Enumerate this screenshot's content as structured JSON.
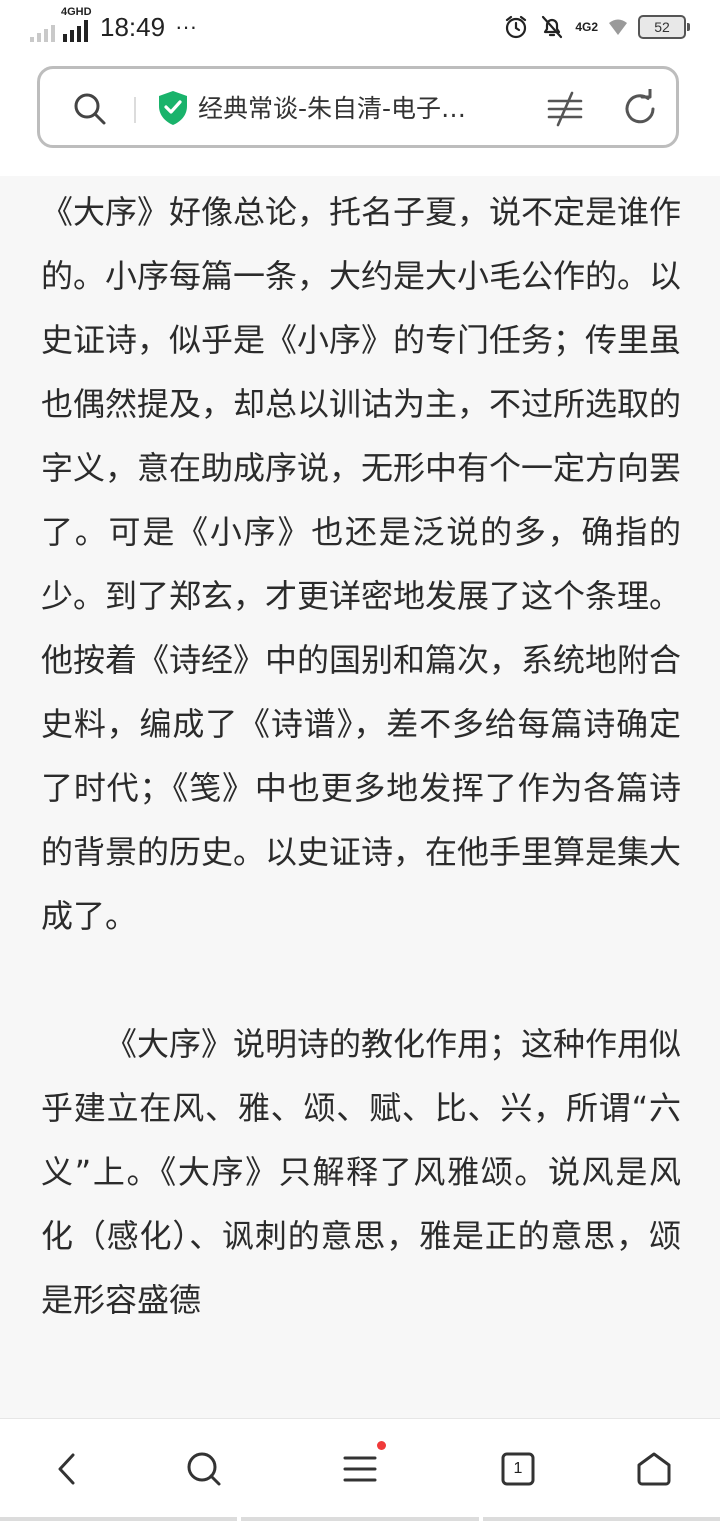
{
  "status_bar": {
    "network_label": "4GHD",
    "time": "18:49",
    "more": "···",
    "network_label_2": "4G2",
    "battery": "52"
  },
  "address_bar": {
    "title": "经典常谈-朱自清-电子…"
  },
  "article": {
    "paragraphs": [
      "《大序》好像总论，托名子夏，说不定是谁作的。小序每篇一条，大约是大小毛公作的。以史证诗，似乎是《小序》的专门任务；传里虽也偶然提及，却总以训诂为主，不过所选取的字义，意在助成序说，无形中有个一定方向罢了。可是《小序》也还是泛说的多，确指的少。到了郑玄，才更详密地发展了这个条理。他按着《诗经》中的国别和篇次，系统地附合史料，编成了《诗谱》，差不多给每篇诗确定了时代；《笺》中也更多地发挥了作为各篇诗的背景的历史。以史证诗，在他手里算是集大成了。",
      "《大序》说明诗的教化作用；这种作用似乎建立在风、雅、颂、赋、比、兴，所谓“六义”上。《大序》只解释了风雅颂。说风是风化（感化）、讽刺的意思，雅是正的意思，颂是形容盛德"
    ]
  },
  "nav": {
    "tabs_count": "1"
  },
  "icons": {
    "search": "search-icon",
    "secure": "shield-check-icon",
    "reader": "reader-mode-icon",
    "refresh": "refresh-icon",
    "back": "back-icon",
    "menu": "menu-icon",
    "tabs": "tabs-icon",
    "home": "home-icon"
  },
  "colors": {
    "shield": "#19b36b",
    "notification_dot": "#f03a3a"
  }
}
